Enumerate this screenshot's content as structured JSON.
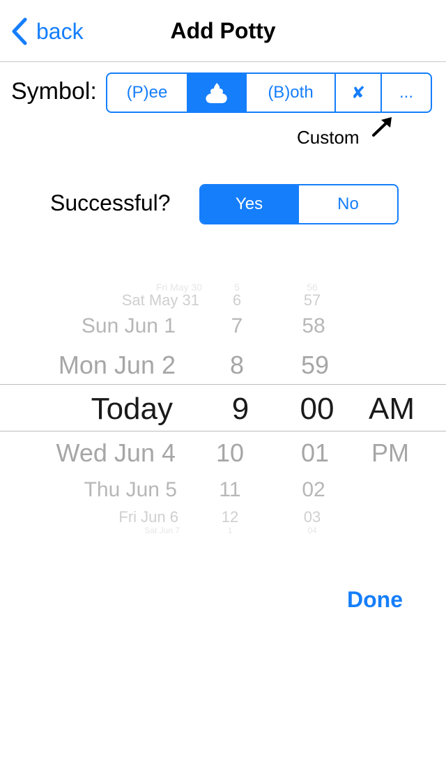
{
  "nav": {
    "back_label": "back",
    "title": "Add Potty"
  },
  "symbol": {
    "label": "Symbol:",
    "options": [
      "(P)ee",
      "",
      "(B)oth",
      "✘",
      "..."
    ],
    "selected_icon": "poop-icon",
    "custom_hint": "Custom"
  },
  "successful": {
    "label": "Successful?",
    "options": [
      "Yes",
      "No"
    ],
    "selected": "Yes"
  },
  "picker": {
    "dates": [
      "Fri May 30",
      "Sat May 31",
      "Sun Jun 1",
      "Mon Jun 2",
      "Today",
      "Wed Jun 4",
      "Thu Jun 5",
      "Fri Jun 6",
      "Sat Jun 7"
    ],
    "hours": [
      "5",
      "6",
      "7",
      "8",
      "9",
      "10",
      "11",
      "12",
      "1"
    ],
    "minutes": [
      "56",
      "57",
      "58",
      "59",
      "00",
      "01",
      "02",
      "03",
      "04"
    ],
    "ampm": [
      "AM",
      "PM"
    ],
    "selected": {
      "date": "Today",
      "hour": "9",
      "minute": "00",
      "ampm": "AM"
    }
  },
  "done_label": "Done",
  "colors": {
    "accent": "#157efb",
    "separator": "#c8c7cc"
  }
}
